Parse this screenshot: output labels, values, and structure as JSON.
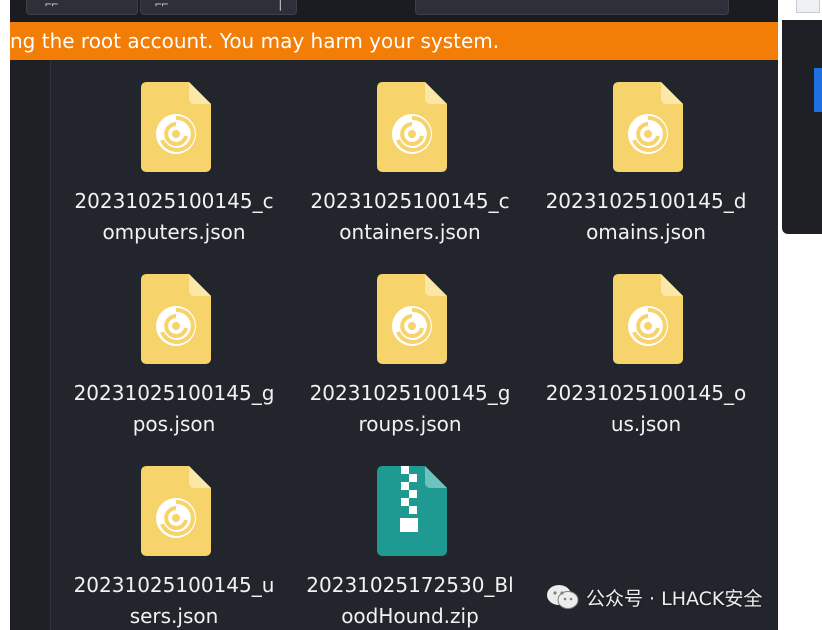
{
  "warning": {
    "text": "ng the root account. You may harm your system."
  },
  "files": [
    {
      "line1": "20231025100145_c",
      "line2": "omputers.json",
      "icon": "json-file-icon"
    },
    {
      "line1": "20231025100145_c",
      "line2": "ontainers.json",
      "icon": "json-file-icon"
    },
    {
      "line1": "20231025100145_d",
      "line2": "omains.json",
      "icon": "json-file-icon"
    },
    {
      "line1": "20231025100145_g",
      "line2": "pos.json",
      "icon": "json-file-icon"
    },
    {
      "line1": "20231025100145_g",
      "line2": "roups.json",
      "icon": "json-file-icon"
    },
    {
      "line1": "20231025100145_o",
      "line2": "us.json",
      "icon": "json-file-icon"
    },
    {
      "line1": "20231025100145_u",
      "line2": "sers.json",
      "icon": "json-file-icon"
    },
    {
      "line1": "20231025172530_Bl",
      "line2": "oodHound.zip",
      "icon": "zip-file-icon"
    }
  ],
  "watermark": {
    "text": "公众号 · LHACK安全",
    "icon": "wechat-icon"
  },
  "colors": {
    "warning_bg": "#f27d07",
    "json_icon": "#f6d36b",
    "zip_icon": "#1f9a93",
    "window_bg": "#23252c"
  }
}
